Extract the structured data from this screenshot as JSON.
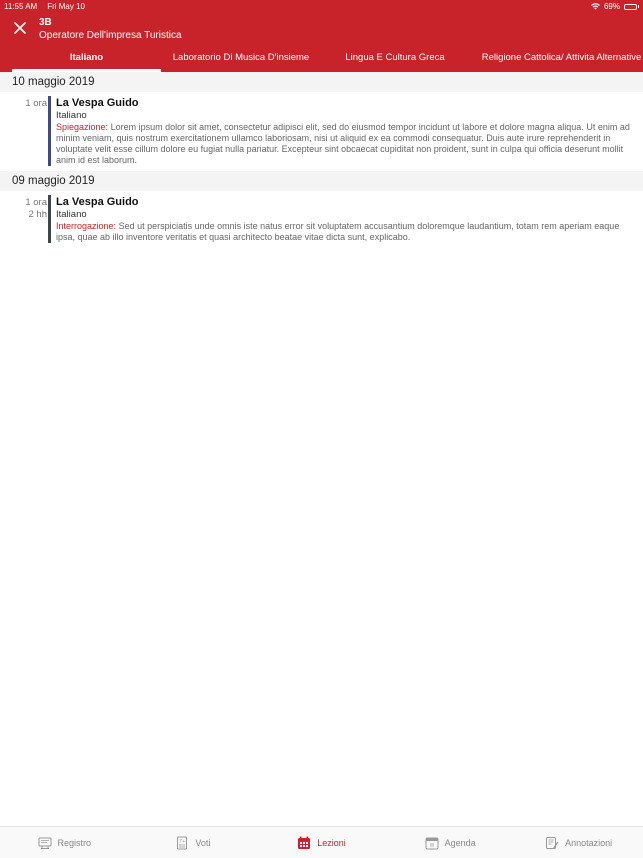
{
  "status": {
    "time": "11:55 AM",
    "date": "Fri May 10",
    "battery": "69%",
    "battery_level": 0.69
  },
  "header": {
    "class_code": "3B",
    "course_name": "Operatore Dell'impresa Turistica"
  },
  "tabs": [
    {
      "label": "Italiano",
      "active": true
    },
    {
      "label": "Laboratorio Di Musica D'insieme",
      "active": false
    },
    {
      "label": "Lingua E Cultura Greca",
      "active": false
    },
    {
      "label": "Religione Cattolica/ Attivita Alternative",
      "active": false
    }
  ],
  "days": [
    {
      "date": "10 maggio 2019",
      "lessons": [
        {
          "hours": [
            "1 ora"
          ],
          "bar_color": "#3a4a8a",
          "teacher": "La Vespa Guido",
          "subject": "Italiano",
          "type": "Spiegazione:",
          "text": "Lorem ipsum dolor sit amet, consectetur adipisci elit, sed do eiusmod tempor incidunt ut labore et dolore magna aliqua. Ut enim ad minim veniam, quis nostrum exercitationem ullamco laboriosam, nisi ut aliquid ex ea commodi consequatur. Duis aute irure reprehenderit in voluptate velit esse cillum dolore eu fugiat nulla pariatur. Excepteur sint obcaecat cupiditat non proident, sunt in culpa qui officia deserunt mollit anim id est laborum."
        }
      ]
    },
    {
      "date": "09 maggio 2019",
      "lessons": [
        {
          "hours": [
            "1 ora",
            "2 hh"
          ],
          "bar_color": "#3b4650",
          "teacher": "La Vespa Guido",
          "subject": "Italiano",
          "type": "Interrogazione:",
          "text": "Sed ut perspiciatis unde omnis iste natus error sit voluptatem accusantium doloremque laudantium, totam rem aperiam eaque ipsa, quae ab illo inventore veritatis et quasi architecto beatae vitae dicta sunt, explicabo."
        }
      ]
    }
  ],
  "bottom_nav": [
    {
      "label": "Registro",
      "icon": "register-icon",
      "active": false
    },
    {
      "label": "Voti",
      "icon": "grades-icon",
      "active": false
    },
    {
      "label": "Lezioni",
      "icon": "lessons-calendar-icon",
      "active": true
    },
    {
      "label": "Agenda",
      "icon": "agenda-calendar-icon",
      "active": false
    },
    {
      "label": "Annotazioni",
      "icon": "notes-icon",
      "active": false
    }
  ],
  "colors": {
    "accent": "#c8222a",
    "header_bg": "#c8222a",
    "date_bg": "#f4f4f4"
  }
}
